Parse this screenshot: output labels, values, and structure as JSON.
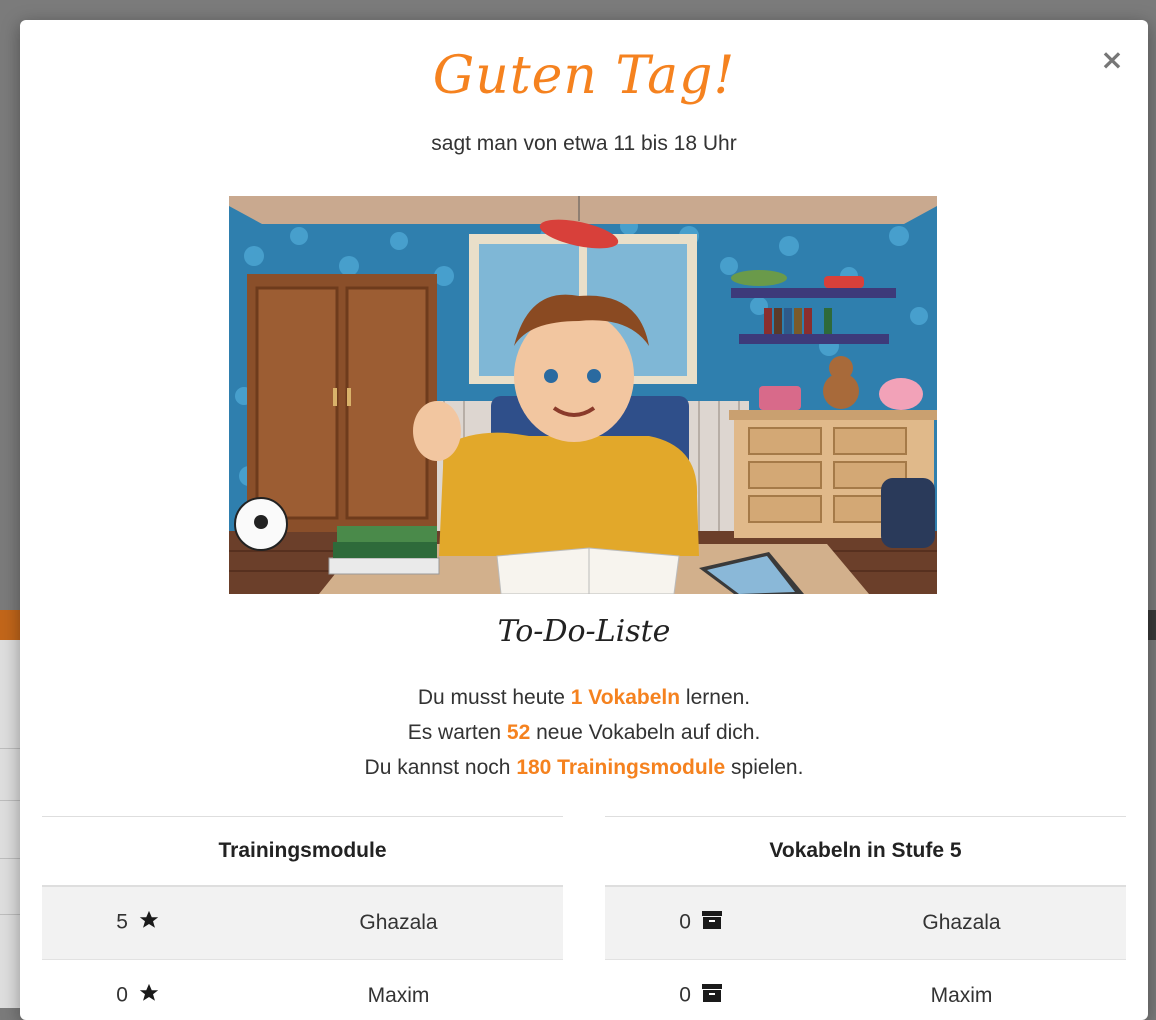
{
  "modal": {
    "close_label": "×",
    "greeting": "Guten Tag!",
    "subtitle": "sagt man von etwa 11 bis 18 Uhr",
    "todo_title": "To-Do-Liste",
    "todo": {
      "line1_pre": "Du musst heute ",
      "line1_hl": "1 Vokabeln",
      "line1_post": " lernen.",
      "line2_pre": "Es warten ",
      "line2_hl": "52",
      "line2_post": " neue Vokabeln auf dich.",
      "line3_pre": "Du kannst noch ",
      "line3_hl": "180 Trainingsmodule",
      "line3_post": " spielen."
    },
    "tables": {
      "left": {
        "header": "Trainingsmodule",
        "icon": "star-icon",
        "rows": [
          {
            "score": "5",
            "name": "Ghazala"
          },
          {
            "score": "0",
            "name": "Maxim"
          }
        ]
      },
      "right": {
        "header": "Vokabeln in Stufe 5",
        "icon": "archive-box-icon",
        "rows": [
          {
            "score": "0",
            "name": "Ghazala"
          },
          {
            "score": "0",
            "name": "Maxim"
          }
        ]
      }
    }
  },
  "colors": {
    "accent": "#f5821f",
    "text": "#333333",
    "row_alt": "#f2f2f2"
  }
}
